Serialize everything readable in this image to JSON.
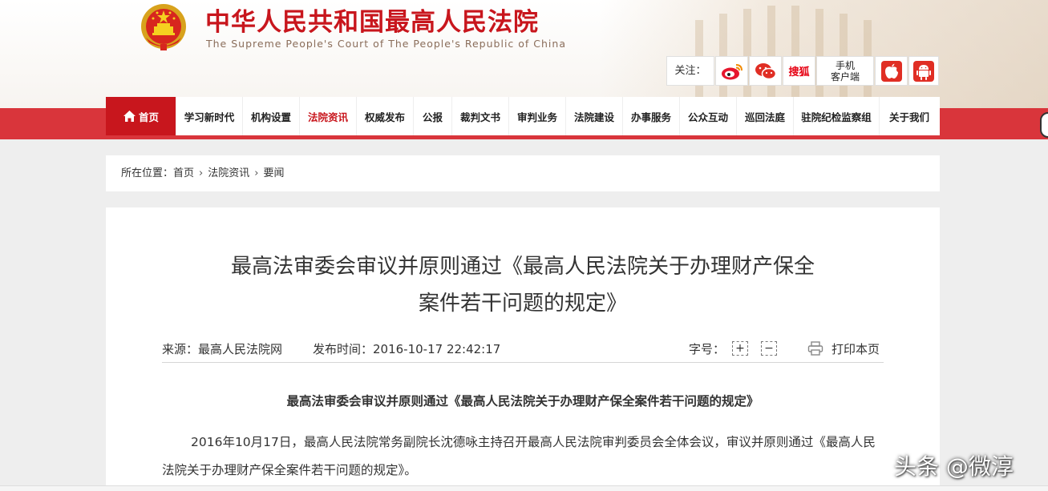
{
  "header": {
    "title": "中华人民共和国最高人民法院",
    "subtitle": "The Supreme People's Court of The People's Republic of China",
    "follow_label": "关注：",
    "social": [
      {
        "name": "weibo-icon"
      },
      {
        "name": "wechat-icon"
      },
      {
        "name": "sohu-icon",
        "label": "搜狐"
      },
      {
        "name": "mobile-client",
        "label_line1": "手机",
        "label_line2": "客户端"
      },
      {
        "name": "apple-icon"
      },
      {
        "name": "android-icon"
      }
    ]
  },
  "nav": {
    "items": [
      {
        "label": "首页"
      },
      {
        "label": "学习新时代"
      },
      {
        "label": "机构设置"
      },
      {
        "label": "法院资讯"
      },
      {
        "label": "权威发布"
      },
      {
        "label": "公报"
      },
      {
        "label": "裁判文书"
      },
      {
        "label": "审判业务"
      },
      {
        "label": "法院建设"
      },
      {
        "label": "办事服务"
      },
      {
        "label": "公众互动"
      },
      {
        "label": "巡回法庭"
      },
      {
        "label": "驻院纪检监察组"
      },
      {
        "label": "关于我们"
      }
    ]
  },
  "breadcrumb": {
    "prefix": "所在位置：",
    "items": [
      "首页",
      "法院资讯",
      "要闻"
    ]
  },
  "article": {
    "title_line1": "最高法审委会审议并原则通过《最高人民法院关于办理财产保全",
    "title_line2": "案件若干问题的规定》",
    "source": "来源：最高人民法院网",
    "time": "发布时间：2016-10-17 22:42:17",
    "font_size_label": "字号：",
    "plus": "+",
    "minus": "−",
    "print": "打印本页",
    "subhead": "最高法审委会审议并原则通过《最高人民法院关于办理财产保全案件若干问题的规定》",
    "paragraph": "2016年10月17日，最高人民法院常务副院长沈德咏主持召开最高人民法院审判委员会全体会议，审议并原则通过《最高人民法院关于办理财产保全案件若干问题的规定》。"
  },
  "watermark": "头条 @微淳",
  "colors": {
    "brand_red": "#c8161d",
    "nav_band": "#d9353b"
  }
}
